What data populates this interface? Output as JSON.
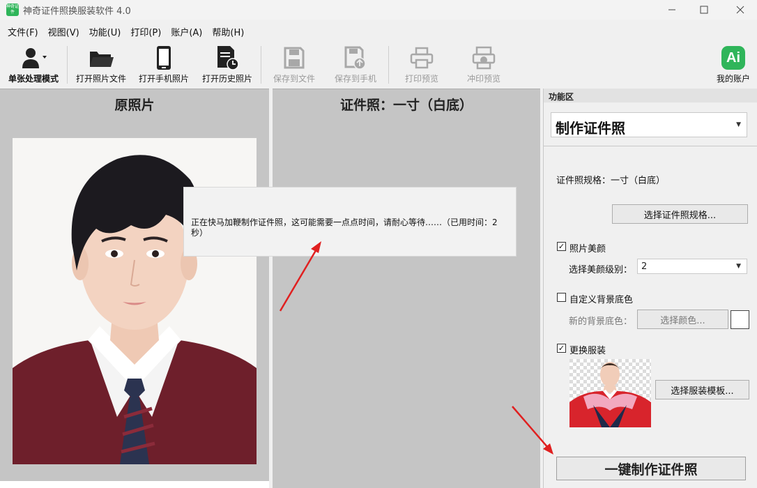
{
  "app": {
    "title": "神奇证件照换服装软件 4.0",
    "icon_text": "神奇证件"
  },
  "menu": [
    "文件(F)",
    "视图(V)",
    "功能(U)",
    "打印(P)",
    "账户(A)",
    "帮助(H)"
  ],
  "toolbar": {
    "single_mode": "单张处理模式",
    "open_photo": "打开照片文件",
    "open_phone": "打开手机照片",
    "open_history": "打开历史照片",
    "save_file": "保存到文件",
    "save_phone": "保存到手机",
    "print_preview": "打印预览",
    "develop_preview": "冲印预览",
    "my_account": "我的账户",
    "ai_badge": "Ai"
  },
  "left_panel": {
    "title": "原照片"
  },
  "mid_panel": {
    "title": "证件照：一寸（白底）"
  },
  "loading": {
    "message": "正在快马加鞭制作证件照，这可能需要一点点时间，请耐心等待……（已用时间：2 秒）"
  },
  "right_panel": {
    "header": "功能区",
    "mode": "制作证件照",
    "spec_label": "证件照规格：一寸（白底）",
    "choose_spec": "选择证件照规格...",
    "beauty_label": "照片美颜",
    "beauty_checked": true,
    "beauty_level_label": "选择美颜级别：",
    "beauty_level": "2",
    "custom_bg_label": "自定义背景底色",
    "custom_bg_checked": false,
    "new_bg_label": "新的背景底色：",
    "choose_color": "选择颜色...",
    "bg_color": "#ffffff",
    "change_clothes_label": "更换服装",
    "change_clothes_checked": true,
    "choose_clothes": "选择服装模板...",
    "make_button": "一键制作证件照"
  },
  "colors": {
    "accent_green": "#2fb55a",
    "panel_gray": "#c5c5c5",
    "arrow_red": "#e02020"
  }
}
